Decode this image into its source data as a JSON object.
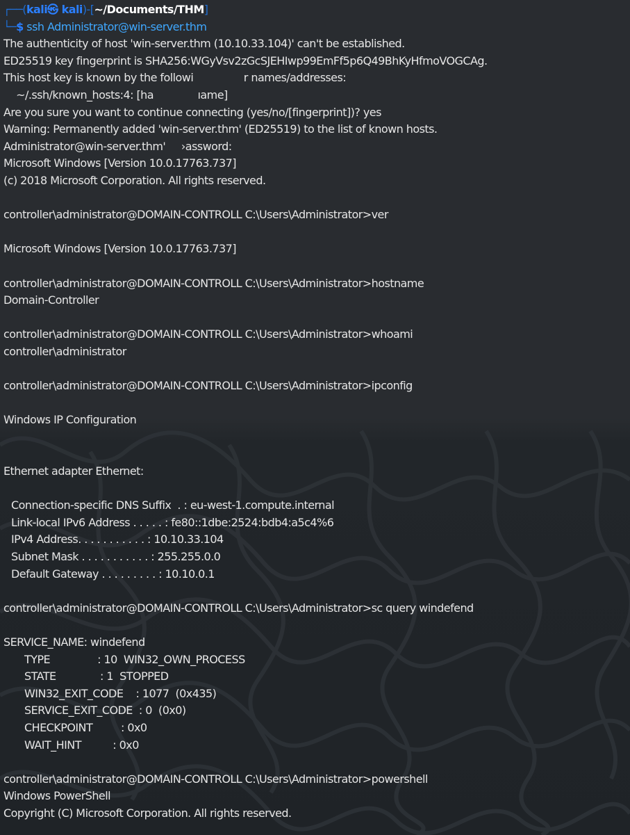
{
  "prompt": {
    "corner_top": "┌──(",
    "user": "kali㉿ kali",
    "sep": ")-[",
    "path": "~/Documents/THM",
    "close": "]",
    "corner_bottom": "└─",
    "dollar": "$",
    "command": " ssh Administrator@win-server.thm"
  },
  "lines": {
    "l1": "The authenticity of host 'win-server.thm (10.10.33.104)' can't be established.",
    "l2": "ED25519 key fingerprint is SHA256:WGyVsv2zGcSJEHIwp99EmFf5p6Q49BhKyHfmoVOGCAg.",
    "l3": "This host key is known by the followi                r names/addresses:",
    "l4": "    ~/.ssh/known_hosts:4: [ha              ıame]",
    "l5": "Are you sure you want to continue connecting (yes/no/[fingerprint])? yes",
    "l6": "Warning: Permanently added 'win-server.thm' (ED25519) to the list of known hosts.",
    "l7": "Administrator@win-server.thm'     ›assword:",
    "l8": "Microsoft Windows [Version 10.0.17763.737]",
    "l9": "(c) 2018 Microsoft Corporation. All rights reserved.",
    "l10": "controller\\administrator@DOMAIN-CONTROLL C:\\Users\\Administrator>ver",
    "l11": "Microsoft Windows [Version 10.0.17763.737]",
    "l12": "controller\\administrator@DOMAIN-CONTROLL C:\\Users\\Administrator>hostname",
    "l13": "Domain-Controller",
    "l14": "controller\\administrator@DOMAIN-CONTROLL C:\\Users\\Administrator>whoami",
    "l15": "controller\\administrator",
    "l16": "controller\\administrator@DOMAIN-CONTROLL C:\\Users\\Administrator>ipconfig",
    "l17": "Windows IP Configuration",
    "l18": "Ethernet adapter Ethernet:",
    "l19": "Connection-specific DNS Suffix  . : eu-west-1.compute.internal",
    "l20": "Link-local IPv6 Address . . . . . : fe80::1dbe:2524:bdb4:a5c4%6",
    "l21": "IPv4 Address. . . . . . . . . . . : 10.10.33.104",
    "l22": "Subnet Mask . . . . . . . . . . . : 255.255.0.0",
    "l23": "Default Gateway . . . . . . . . . : 10.10.0.1",
    "l24": "controller\\administrator@DOMAIN-CONTROLL C:\\Users\\Administrator>sc query windefend",
    "l25": "SERVICE_NAME: windefend",
    "l26": "TYPE               : 10  WIN32_OWN_PROCESS",
    "l27": "STATE              : 1  STOPPED",
    "l28": "WIN32_EXIT_CODE    : 1077  (0x435)",
    "l29": "SERVICE_EXIT_CODE  : 0  (0x0)",
    "l30": "CHECKPOINT         : 0x0",
    "l31": "WAIT_HINT          : 0x0",
    "l32": "controller\\administrator@DOMAIN-CONTROLL C:\\Users\\Administrator>powershell",
    "l33": "Windows PowerShell",
    "l34": "Copyright (C) Microsoft Corporation. All rights reserved."
  },
  "colors": {
    "background": "#292c30",
    "text": "#e6e6e6",
    "prompt_blue": "#2b7fff",
    "command_blue": "#3fa8ff"
  }
}
